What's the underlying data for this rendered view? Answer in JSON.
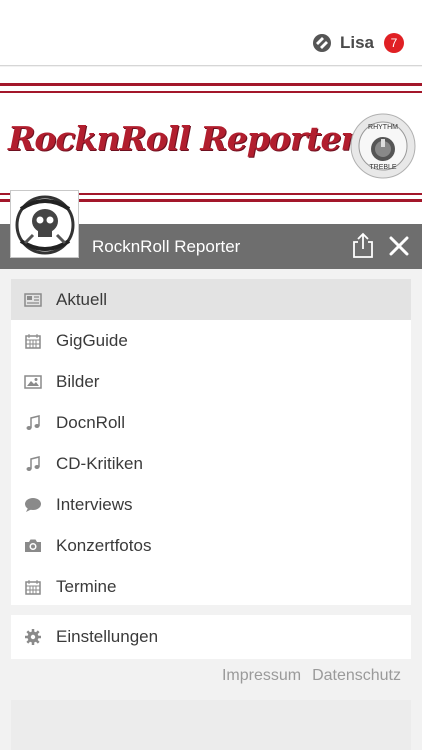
{
  "header": {
    "user_name": "Lisa",
    "notification_count": "7"
  },
  "banner": {
    "title": "RocknRoll Reporter",
    "knob_top_text": "RHYTHM",
    "knob_bottom_text": "TREBLE"
  },
  "appbar": {
    "title": "RocknRoll Reporter"
  },
  "menu": {
    "items": [
      {
        "label": "Aktuell",
        "icon": "newspaper-icon",
        "active": true
      },
      {
        "label": "GigGuide",
        "icon": "calendar-icon",
        "active": false
      },
      {
        "label": "Bilder",
        "icon": "image-icon",
        "active": false
      },
      {
        "label": "DocnRoll",
        "icon": "music-note-icon",
        "active": false
      },
      {
        "label": "CD-Kritiken",
        "icon": "music-note-icon",
        "active": false
      },
      {
        "label": "Interviews",
        "icon": "speech-bubble-icon",
        "active": false
      },
      {
        "label": "Konzertfotos",
        "icon": "camera-icon",
        "active": false
      },
      {
        "label": "Termine",
        "icon": "calendar-icon",
        "active": false
      }
    ],
    "settings_label": "Einstellungen"
  },
  "footer": {
    "impressum": "Impressum",
    "datenschutz": "Datenschutz"
  },
  "colors": {
    "accent_red": "#a3172a",
    "badge_red": "#e02024",
    "appbar_gray": "#6e6e6e"
  }
}
